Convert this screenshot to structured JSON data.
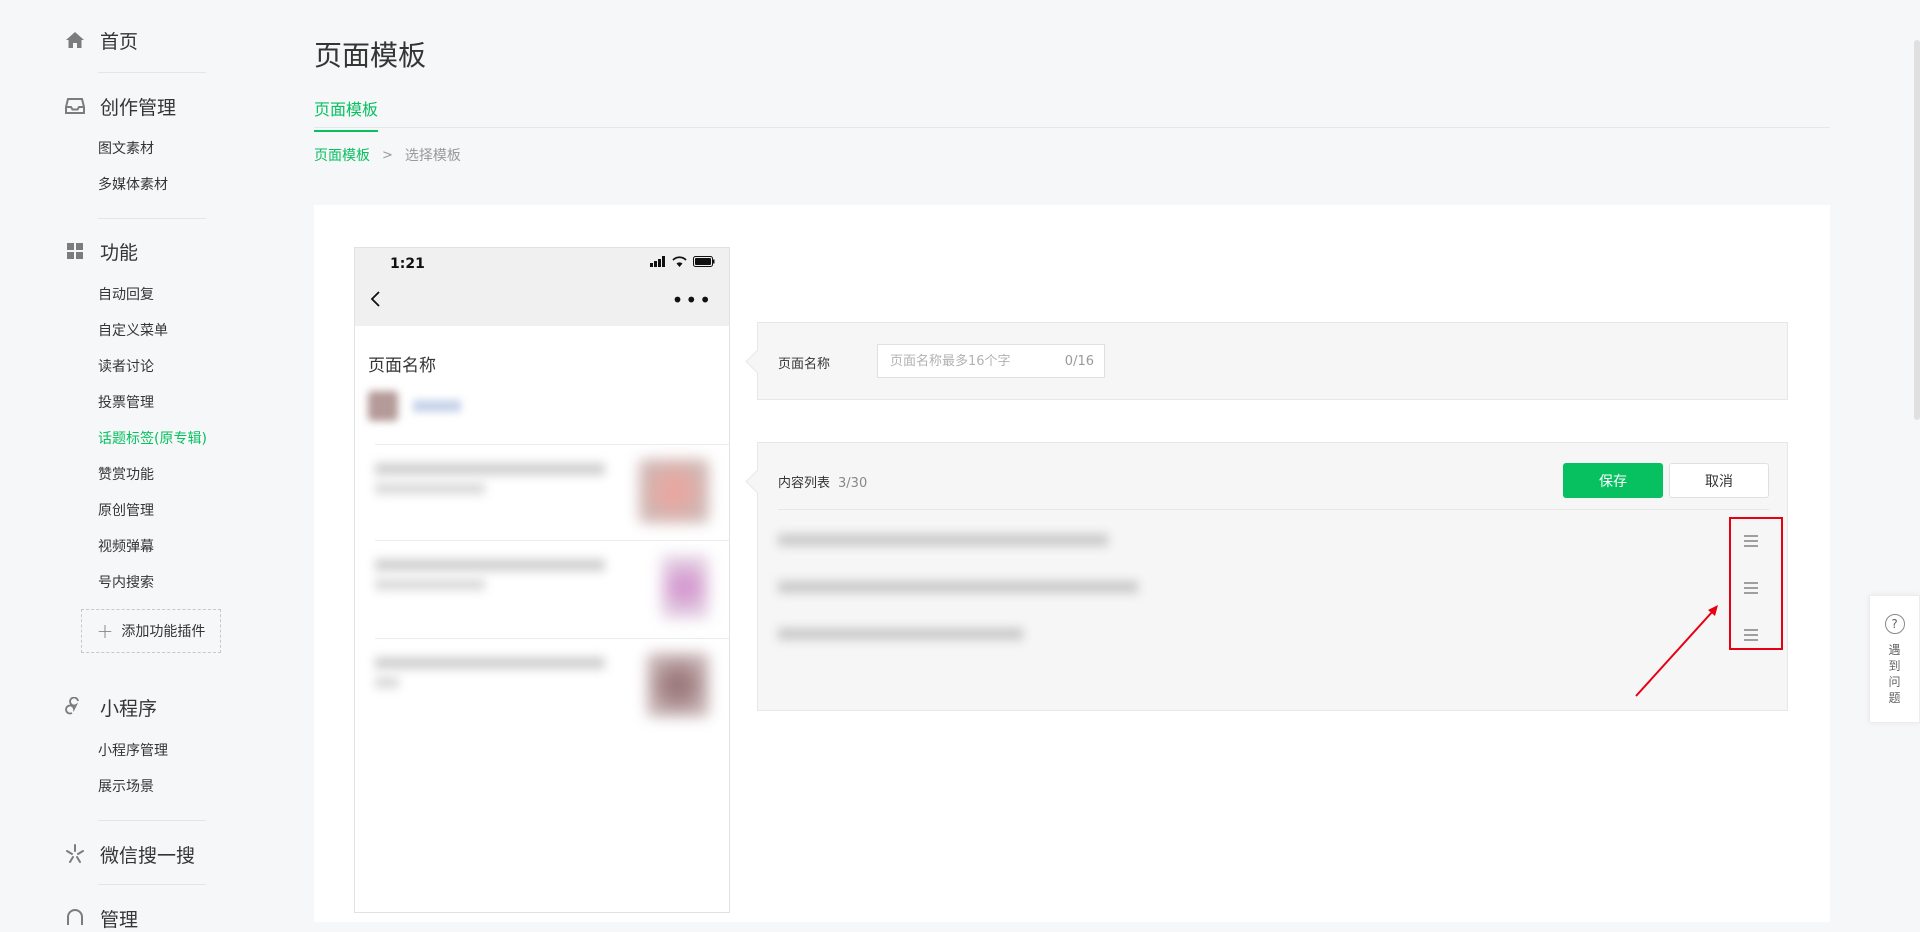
{
  "sidebar": {
    "home": {
      "label": "首页"
    },
    "creation": {
      "label": "创作管理",
      "items": [
        "图文素材",
        "多媒体素材"
      ]
    },
    "features": {
      "label": "功能",
      "items": [
        "自动回复",
        "自定义菜单",
        "读者讨论",
        "投票管理",
        "话题标签(原专辑)",
        "赞赏功能",
        "原创管理",
        "视频弹幕",
        "号内搜索"
      ],
      "add_plugin": "添加功能插件"
    },
    "miniprogram": {
      "label": "小程序",
      "items": [
        "小程序管理",
        "展示场景"
      ]
    },
    "search": {
      "label": "微信搜一搜"
    },
    "manage": {
      "label": "管理"
    }
  },
  "header": {
    "title": "页面模板",
    "tab": "页面模板",
    "breadcrumb": {
      "link": "页面模板",
      "separator": ">",
      "current": "选择模板"
    }
  },
  "phone": {
    "time": "1:21",
    "page_name": "页面名称"
  },
  "form": {
    "name_label": "页面名称",
    "name_placeholder": "页面名称最多16个字",
    "name_count": "0/16",
    "list_label": "内容列表",
    "list_count": "3/30",
    "save": "保存",
    "cancel": "取消"
  },
  "help": {
    "label": "遇到问题"
  },
  "colors": {
    "accent": "#07c160",
    "highlight": "#e60012"
  }
}
